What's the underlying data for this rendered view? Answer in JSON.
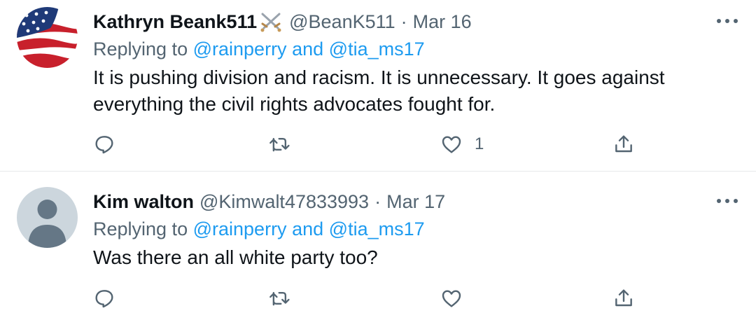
{
  "tweets": [
    {
      "name": "Kathryn Beank511",
      "handle": "@BeanK511",
      "separator": "·",
      "date": "Mar 16",
      "replying_prefix": "Replying to",
      "mention_1": "@rainperry",
      "and": "and",
      "mention_2": "@tia_ms17",
      "text": "It is pushing division and racism. It is unnecessary. It goes against everything the civil rights advocates fought for.",
      "like_count": "1",
      "avatar": "us-flag-avatar",
      "badge": "crossed-swords-icon"
    },
    {
      "name": "Kim walton",
      "handle": "@Kimwalt47833993",
      "separator": "·",
      "date": "Mar 17",
      "replying_prefix": "Replying to",
      "mention_1": "@rainperry",
      "and": "and",
      "mention_2": "@tia_ms17",
      "text": "Was there an all white party too?",
      "like_count": "",
      "avatar": "default-avatar"
    }
  ],
  "icons": [
    "reply-icon",
    "retweet-icon",
    "like-icon",
    "share-icon",
    "more-icon"
  ],
  "colors": {
    "text": "#0f1419",
    "secondary": "#536471",
    "link": "#1d9bf0",
    "divider": "#e7e9ea"
  }
}
